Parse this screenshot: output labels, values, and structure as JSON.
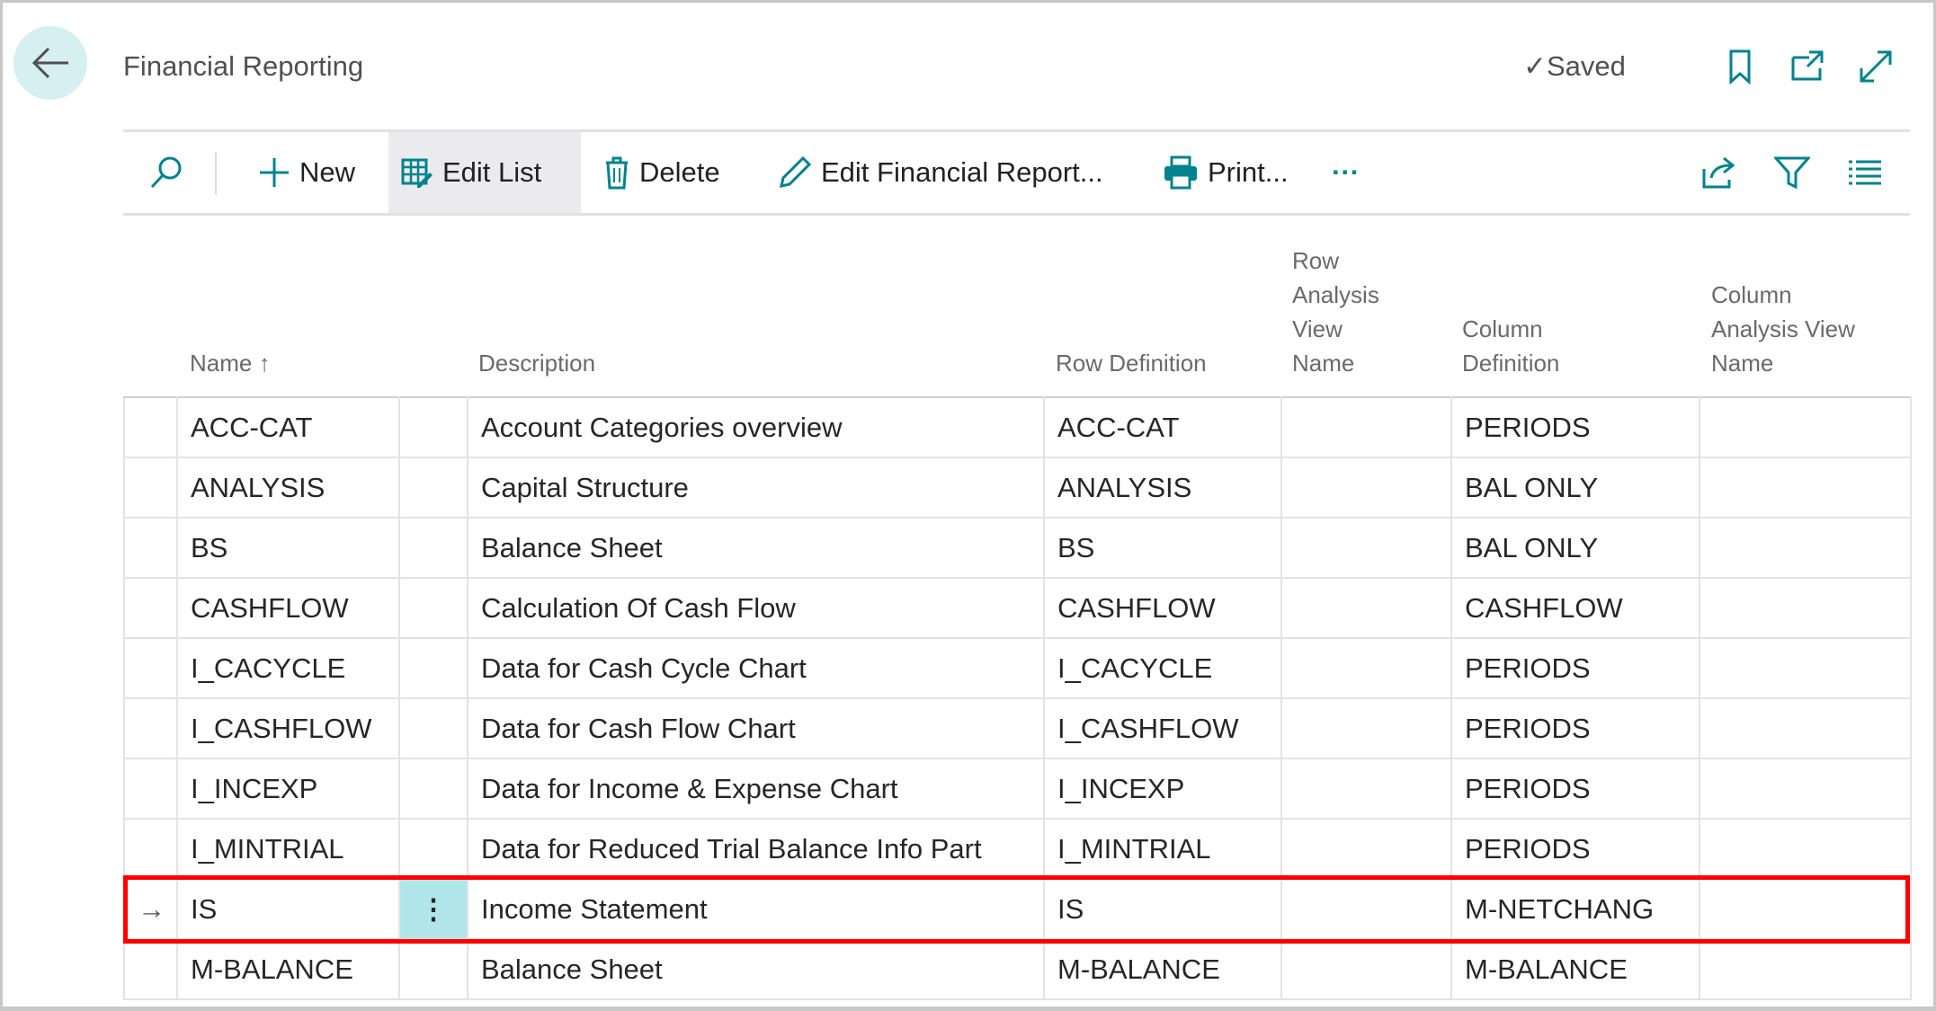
{
  "header": {
    "title": "Financial Reporting",
    "saved": "Saved"
  },
  "toolbar": {
    "new": "New",
    "edit_list": "Edit List",
    "delete": "Delete",
    "edit_report": "Edit Financial Report...",
    "print": "Print...",
    "more": "···"
  },
  "columns": {
    "name": "Name ↑",
    "description": "Description",
    "row_definition": "Row Definition",
    "row_analysis": [
      "Row",
      "Analysis",
      "View",
      "Name"
    ],
    "column_definition": [
      "Column",
      "Definition"
    ],
    "column_analysis": [
      "Column",
      "Analysis View",
      "Name"
    ]
  },
  "rows": [
    {
      "name": "ACC-CAT",
      "description": "Account Categories overview",
      "row_def": "ACC-CAT",
      "col_def": "PERIODS"
    },
    {
      "name": "ANALYSIS",
      "description": "Capital Structure",
      "row_def": "ANALYSIS",
      "col_def": "BAL ONLY"
    },
    {
      "name": "BS",
      "description": "Balance Sheet",
      "row_def": "BS",
      "col_def": "BAL ONLY"
    },
    {
      "name": "CASHFLOW",
      "description": "Calculation Of Cash Flow",
      "row_def": "CASHFLOW",
      "col_def": "CASHFLOW"
    },
    {
      "name": "I_CACYCLE",
      "description": "Data for Cash Cycle Chart",
      "row_def": "I_CACYCLE",
      "col_def": "PERIODS"
    },
    {
      "name": "I_CASHFLOW",
      "description": "Data for Cash Flow Chart",
      "row_def": "I_CASHFLOW",
      "col_def": "PERIODS"
    },
    {
      "name": "I_INCEXP",
      "description": "Data for Income & Expense Chart",
      "row_def": "I_INCEXP",
      "col_def": "PERIODS"
    },
    {
      "name": "I_MINTRIAL",
      "description": "Data for Reduced Trial Balance Info Part",
      "row_def": "I_MINTRIAL",
      "col_def": "PERIODS"
    },
    {
      "name": "IS",
      "description": "Income Statement",
      "row_def": "IS",
      "col_def": "M-NETCHANG",
      "selected": true
    },
    {
      "name": "M-BALANCE",
      "description": "Balance Sheet",
      "row_def": "M-BALANCE",
      "col_def": "M-BALANCE"
    }
  ],
  "colors": {
    "accent": "#00838f",
    "highlight": "#ff0000",
    "selected_cell": "#b0e6ea"
  }
}
